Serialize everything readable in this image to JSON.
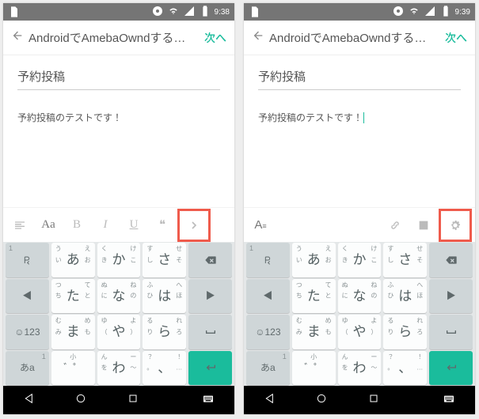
{
  "screens": [
    {
      "status": {
        "time": "9:38"
      },
      "appbar": {
        "title": "AndroidでAmebaOwndする…",
        "next": "次へ"
      },
      "postTitle": "予約投稿",
      "postBody": "予約投稿のテストです！",
      "showCursor": false,
      "toolbar": {
        "mode": "format",
        "highlightIndex": 6,
        "items": [
          {
            "name": "align-icon",
            "glyph": "align"
          },
          {
            "name": "text-size-icon",
            "glyph": "Aa",
            "style": "dark"
          },
          {
            "name": "bold-icon",
            "glyph": "B"
          },
          {
            "name": "italic-icon",
            "glyph": "I",
            "it": true
          },
          {
            "name": "underline-icon",
            "glyph": "U",
            "ul": true
          },
          {
            "name": "quote-icon",
            "glyph": "❝"
          },
          {
            "name": "more-icon",
            "glyph": "chevron"
          }
        ]
      }
    },
    {
      "status": {
        "time": "9:39"
      },
      "appbar": {
        "title": "AndroidでAmebaOwndする…",
        "next": "次へ"
      },
      "postTitle": "予約投稿",
      "postBody": "予約投稿のテストです！",
      "showCursor": true,
      "toolbar": {
        "mode": "insert",
        "highlightIndex": 4,
        "items": [
          {
            "name": "text-mode-icon",
            "glyph": "Atext",
            "style": "dark"
          },
          {
            "name": "spacer",
            "glyph": "spacer"
          },
          {
            "name": "link-icon",
            "glyph": "link"
          },
          {
            "name": "image-icon",
            "glyph": "image"
          },
          {
            "name": "settings-icon",
            "glyph": "gear"
          }
        ]
      }
    }
  ],
  "keyboard": {
    "rows": [
      [
        {
          "fn": true,
          "sub": "1",
          "main": "fnL",
          "name": "key-prev-candidate"
        },
        {
          "tl": "う",
          "tr": "え",
          "l": "い",
          "main": "あ",
          "r": "お",
          "name": "key-a"
        },
        {
          "tl": "く",
          "tr": "け",
          "l": "き",
          "main": "か",
          "r": "こ",
          "name": "key-ka"
        },
        {
          "tl": "す",
          "tr": "せ",
          "l": "し",
          "main": "さ",
          "r": "そ",
          "name": "key-sa"
        },
        {
          "fn": true,
          "main": "bksp",
          "name": "key-backspace"
        }
      ],
      [
        {
          "fn": true,
          "main": "◀",
          "small": true,
          "name": "key-left"
        },
        {
          "tl": "つ",
          "tr": "て",
          "l": "ち",
          "main": "た",
          "r": "と",
          "name": "key-ta"
        },
        {
          "tl": "ぬ",
          "tr": "ね",
          "l": "に",
          "main": "な",
          "r": "の",
          "name": "key-na"
        },
        {
          "tl": "ふ",
          "tr": "へ",
          "l": "ひ",
          "main": "は",
          "r": "ほ",
          "name": "key-ha"
        },
        {
          "fn": true,
          "main": "▶",
          "small": true,
          "name": "key-right"
        }
      ],
      [
        {
          "fn": true,
          "main": "☺123",
          "small": true,
          "name": "key-symbols"
        },
        {
          "tl": "む",
          "tr": "め",
          "l": "み",
          "main": "ま",
          "r": "も",
          "name": "key-ma"
        },
        {
          "tl": "ゆ",
          "tr": "よ",
          "l": "（",
          "main": "や",
          "r": "）",
          "name": "key-ya"
        },
        {
          "tl": "る",
          "tr": "れ",
          "l": "り",
          "main": "ら",
          "r": "ろ",
          "name": "key-ra"
        },
        {
          "fn": true,
          "main": "space",
          "name": "key-space"
        }
      ],
      [
        {
          "fn": true,
          "main": "あa",
          "small": true,
          "sub2": "1",
          "name": "key-mode"
        },
        {
          "t": "小",
          "main": "゛゜",
          "small": true,
          "name": "key-dakuten"
        },
        {
          "tl": "ん",
          "tr": "ー",
          "l": "を",
          "main": "わ",
          "r": "〜",
          "name": "key-wa"
        },
        {
          "tl": "？",
          "tr": "！",
          "l": "。",
          "main": "、",
          "r": "…",
          "name": "key-punc"
        },
        {
          "fn": true,
          "enter": true,
          "name": "key-enter"
        }
      ]
    ]
  }
}
